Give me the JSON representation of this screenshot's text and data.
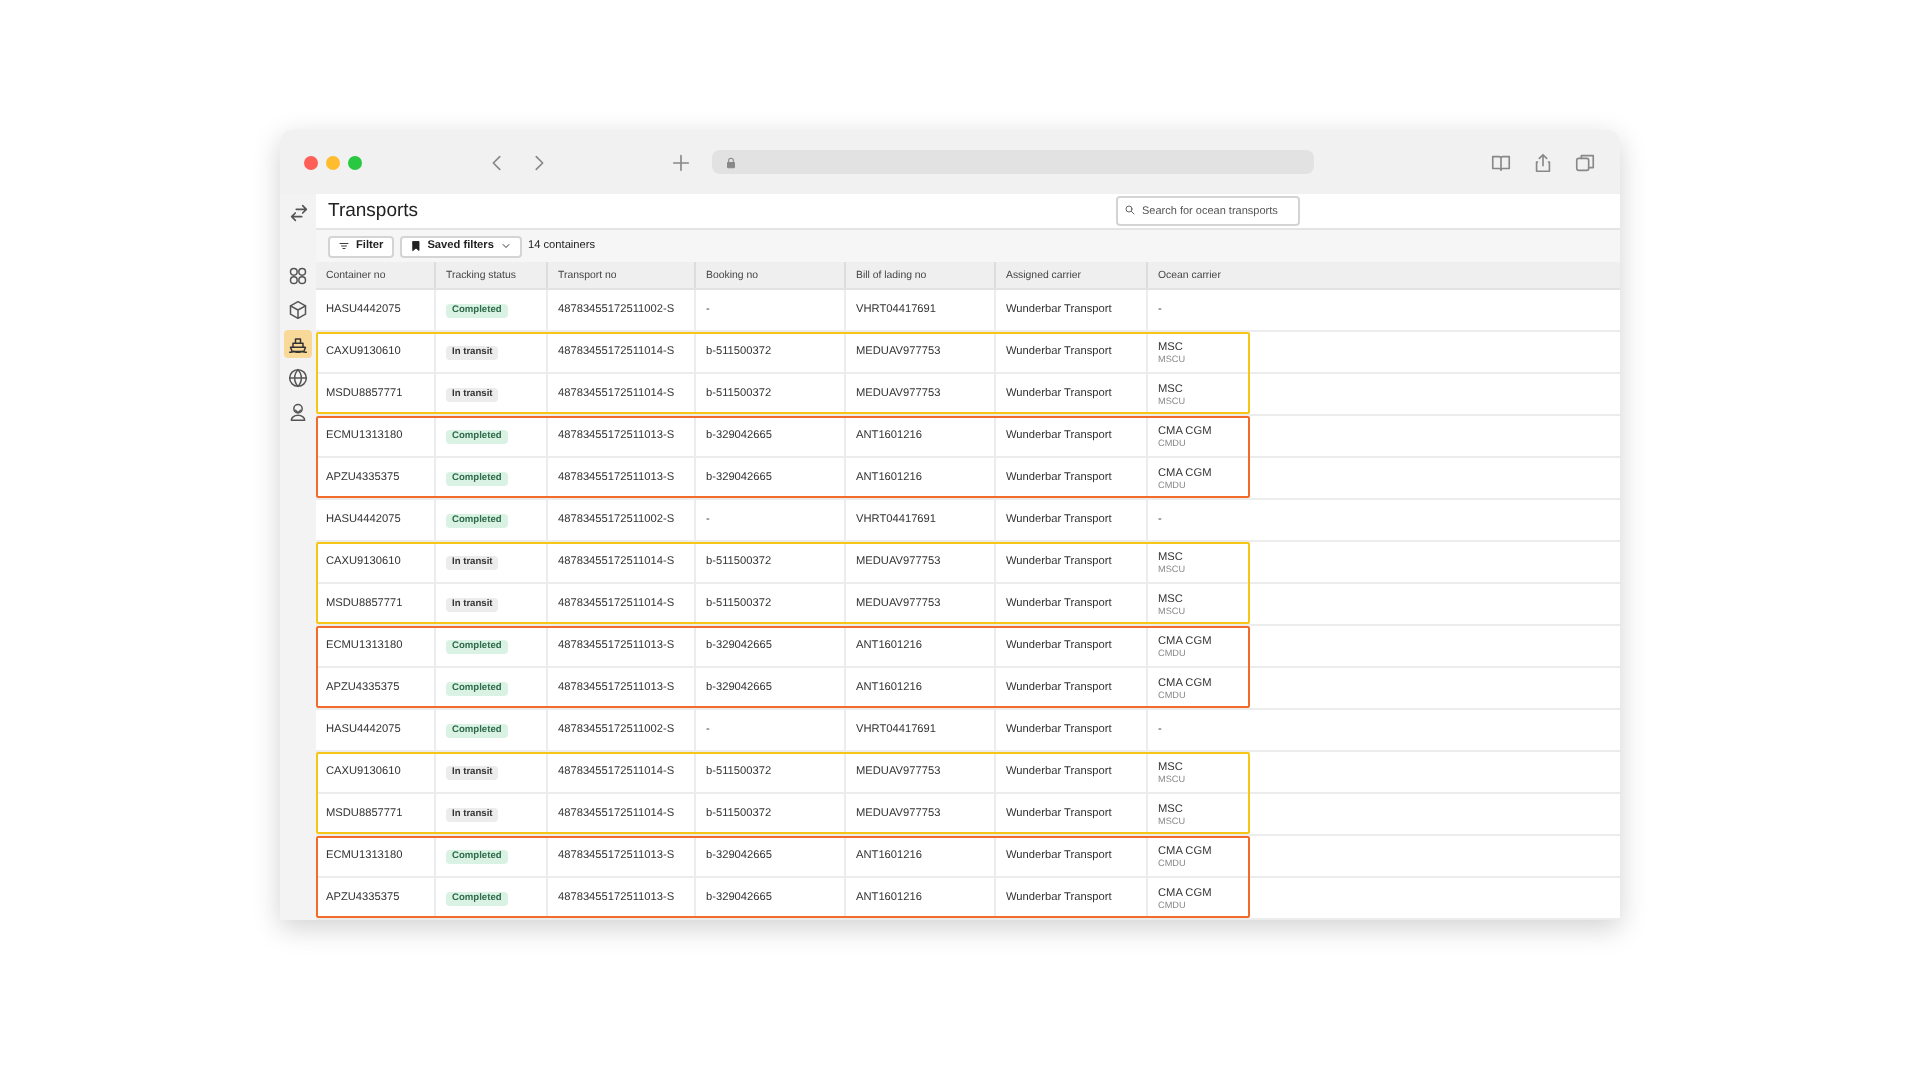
{
  "window": {
    "title": "Transports"
  },
  "sidebar": {
    "items": [
      {
        "selected": false
      },
      {
        "selected": false
      },
      {
        "selected": true
      },
      {
        "selected": false
      },
      {
        "selected": false
      }
    ]
  },
  "search": {
    "placeholder": "Search for ocean transports"
  },
  "toolbar": {
    "filter": "Filter",
    "saved_filters": "Saved filters",
    "count": "14 containers"
  },
  "table": {
    "columns": [
      "Container no",
      "Tracking status",
      "Transport no",
      "Booking no",
      "Bill of lading no",
      "Assigned carrier",
      "Ocean carrier"
    ],
    "groups": [
      {
        "rows": [
          {
            "container": "HASU4442075",
            "status": {
              "label": "Completed",
              "kind": "completed"
            },
            "transport": "48783455172511002-S",
            "booking": "-",
            "bill": "VHRT04417691",
            "carrier": "Wunderbar Transport",
            "ocean": {
              "name": "-"
            }
          }
        ]
      },
      {
        "color": "#f5c518",
        "rows": [
          {
            "container": "CAXU9130610",
            "status": {
              "label": "In transit",
              "kind": "transit"
            },
            "transport": "48783455172511014-S",
            "booking": "b-511500372",
            "bill": "MEDUAV977753",
            "carrier": "Wunderbar Transport",
            "ocean": {
              "name": "MSC",
              "code": "MSCU"
            }
          },
          {
            "container": "MSDU8857771",
            "status": {
              "label": "In transit",
              "kind": "transit"
            },
            "transport": "48783455172511014-S",
            "booking": "b-511500372",
            "bill": "MEDUAV977753",
            "carrier": "Wunderbar Transport",
            "ocean": {
              "name": "MSC",
              "code": "MSCU"
            }
          }
        ]
      },
      {
        "color": "#f26b2a",
        "rows": [
          {
            "container": "ECMU1313180",
            "status": {
              "label": "Completed",
              "kind": "completed"
            },
            "transport": "48783455172511013-S",
            "booking": "b-329042665",
            "bill": "ANT1601216",
            "carrier": "Wunderbar Transport",
            "ocean": {
              "name": "CMA CGM",
              "code": "CMDU"
            }
          },
          {
            "container": "APZU4335375",
            "status": {
              "label": "Completed",
              "kind": "completed"
            },
            "transport": "48783455172511013-S",
            "booking": "b-329042665",
            "bill": "ANT1601216",
            "carrier": "Wunderbar Transport",
            "ocean": {
              "name": "CMA CGM",
              "code": "CMDU"
            }
          }
        ]
      },
      {
        "rows": [
          {
            "container": "HASU4442075",
            "status": {
              "label": "Completed",
              "kind": "completed"
            },
            "transport": "48783455172511002-S",
            "booking": "-",
            "bill": "VHRT04417691",
            "carrier": "Wunderbar Transport",
            "ocean": {
              "name": "-"
            }
          }
        ]
      },
      {
        "color": "#f5c518",
        "rows": [
          {
            "container": "CAXU9130610",
            "status": {
              "label": "In transit",
              "kind": "transit"
            },
            "transport": "48783455172511014-S",
            "booking": "b-511500372",
            "bill": "MEDUAV977753",
            "carrier": "Wunderbar Transport",
            "ocean": {
              "name": "MSC",
              "code": "MSCU"
            }
          },
          {
            "container": "MSDU8857771",
            "status": {
              "label": "In transit",
              "kind": "transit"
            },
            "transport": "48783455172511014-S",
            "booking": "b-511500372",
            "bill": "MEDUAV977753",
            "carrier": "Wunderbar Transport",
            "ocean": {
              "name": "MSC",
              "code": "MSCU"
            }
          }
        ]
      },
      {
        "color": "#f26b2a",
        "rows": [
          {
            "container": "ECMU1313180",
            "status": {
              "label": "Completed",
              "kind": "completed"
            },
            "transport": "48783455172511013-S",
            "booking": "b-329042665",
            "bill": "ANT1601216",
            "carrier": "Wunderbar Transport",
            "ocean": {
              "name": "CMA CGM",
              "code": "CMDU"
            }
          },
          {
            "container": "APZU4335375",
            "status": {
              "label": "Completed",
              "kind": "completed"
            },
            "transport": "48783455172511013-S",
            "booking": "b-329042665",
            "bill": "ANT1601216",
            "carrier": "Wunderbar Transport",
            "ocean": {
              "name": "CMA CGM",
              "code": "CMDU"
            }
          }
        ]
      },
      {
        "rows": [
          {
            "container": "HASU4442075",
            "status": {
              "label": "Completed",
              "kind": "completed"
            },
            "transport": "48783455172511002-S",
            "booking": "-",
            "bill": "VHRT04417691",
            "carrier": "Wunderbar Transport",
            "ocean": {
              "name": "-"
            }
          }
        ]
      },
      {
        "color": "#f5c518",
        "rows": [
          {
            "container": "CAXU9130610",
            "status": {
              "label": "In transit",
              "kind": "transit"
            },
            "transport": "48783455172511014-S",
            "booking": "b-511500372",
            "bill": "MEDUAV977753",
            "carrier": "Wunderbar Transport",
            "ocean": {
              "name": "MSC",
              "code": "MSCU"
            }
          },
          {
            "container": "MSDU8857771",
            "status": {
              "label": "In transit",
              "kind": "transit"
            },
            "transport": "48783455172511014-S",
            "booking": "b-511500372",
            "bill": "MEDUAV977753",
            "carrier": "Wunderbar Transport",
            "ocean": {
              "name": "MSC",
              "code": "MSCU"
            }
          }
        ]
      },
      {
        "color": "#f26b2a",
        "rows": [
          {
            "container": "ECMU1313180",
            "status": {
              "label": "Completed",
              "kind": "completed"
            },
            "transport": "48783455172511013-S",
            "booking": "b-329042665",
            "bill": "ANT1601216",
            "carrier": "Wunderbar Transport",
            "ocean": {
              "name": "CMA CGM",
              "code": "CMDU"
            }
          },
          {
            "container": "APZU4335375",
            "status": {
              "label": "Completed",
              "kind": "completed"
            },
            "transport": "48783455172511013-S",
            "booking": "b-329042665",
            "bill": "ANT1601216",
            "carrier": "Wunderbar Transport",
            "ocean": {
              "name": "CMA CGM",
              "code": "CMDU"
            }
          }
        ]
      }
    ]
  }
}
